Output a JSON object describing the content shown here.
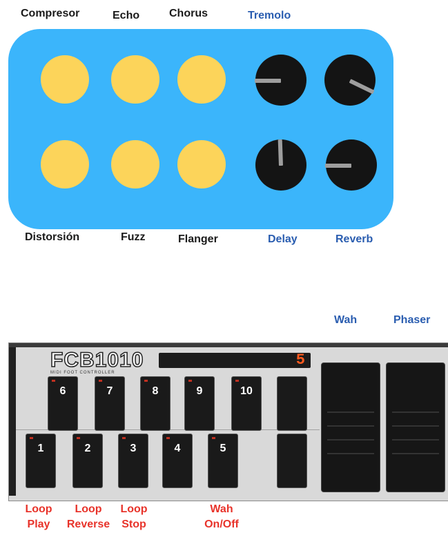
{
  "top_panel": {
    "top_labels": {
      "compresor": "Compresor",
      "echo": "Echo",
      "chorus": "Chorus",
      "tremolo": "Tremolo"
    },
    "bottom_labels": {
      "distorsion": "Distorsión",
      "fuzz": "Fuzz",
      "flanger": "Flanger",
      "delay": "Delay",
      "reverb": "Reverb"
    },
    "colors": {
      "panel": "#3bb5fb",
      "effect_button": "#fcd45a",
      "knob": "#141414",
      "knob_pointer": "#9e9e9e",
      "knob_label": "#2a5db0",
      "effect_label": "#1a1a1a"
    }
  },
  "pedals": {
    "wah": "Wah",
    "phaser": "Phaser"
  },
  "fcb": {
    "logo": "FCB1010",
    "subtitle": "MIDI FOOT CONTROLLER",
    "display": "5",
    "top_row": [
      "6",
      "7",
      "8",
      "9",
      "10"
    ],
    "bottom_row": [
      "1",
      "2",
      "3",
      "4",
      "5"
    ]
  },
  "switch_labels": {
    "loop_play": [
      "Loop",
      "Play"
    ],
    "loop_reverse": [
      "Loop",
      "Reverse"
    ],
    "loop_stop": [
      "Loop",
      "Stop"
    ],
    "wah_onoff": [
      "Wah",
      "On/Off"
    ],
    "color": "#e8332a"
  }
}
